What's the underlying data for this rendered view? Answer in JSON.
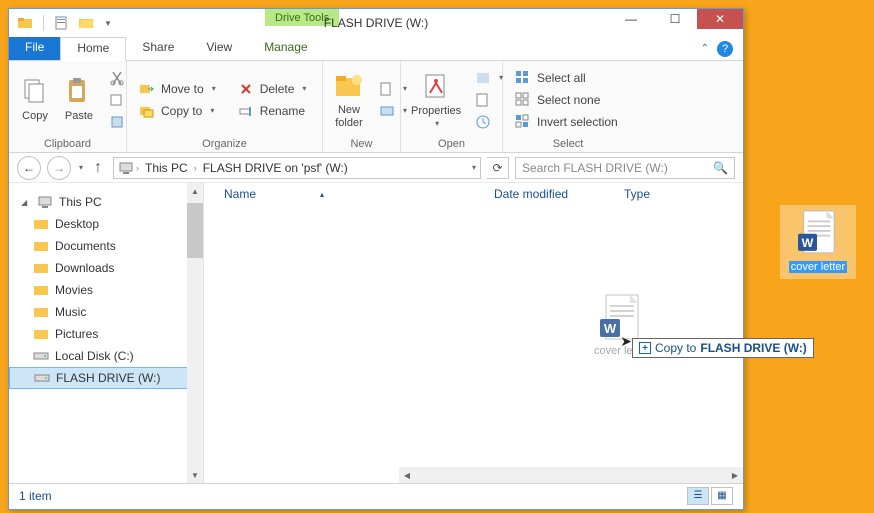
{
  "window": {
    "title": "FLASH DRIVE (W:)",
    "context_tab": "Drive Tools"
  },
  "tabs": {
    "file": "File",
    "home": "Home",
    "share": "Share",
    "view": "View",
    "manage": "Manage"
  },
  "ribbon": {
    "clipboard": {
      "label": "Clipboard",
      "copy": "Copy",
      "paste": "Paste"
    },
    "organize": {
      "label": "Organize",
      "moveto": "Move to",
      "copyto": "Copy to",
      "delete": "Delete",
      "rename": "Rename"
    },
    "new": {
      "label": "New",
      "newfolder": "New\nfolder"
    },
    "open": {
      "label": "Open",
      "properties": "Properties"
    },
    "select": {
      "label": "Select",
      "all": "Select all",
      "none": "Select none",
      "invert": "Invert selection"
    }
  },
  "breadcrumb": {
    "root": "This PC",
    "loc": "FLASH DRIVE on 'psf' (W:)"
  },
  "search": {
    "placeholder": "Search FLASH DRIVE (W:)"
  },
  "columns": {
    "name": "Name",
    "date": "Date modified",
    "type": "Type"
  },
  "tree": {
    "thispc": "This PC",
    "items": [
      "Desktop",
      "Documents",
      "Downloads",
      "Movies",
      "Music",
      "Pictures",
      "Local Disk (C:)",
      "FLASH DRIVE (W:)"
    ]
  },
  "drag": {
    "file": "cover letter",
    "tooltip_prefix": "Copy to ",
    "tooltip_bold": "FLASH DRIVE (W:)"
  },
  "status": {
    "count": "1 item"
  },
  "desktop": {
    "file": "cover letter"
  }
}
